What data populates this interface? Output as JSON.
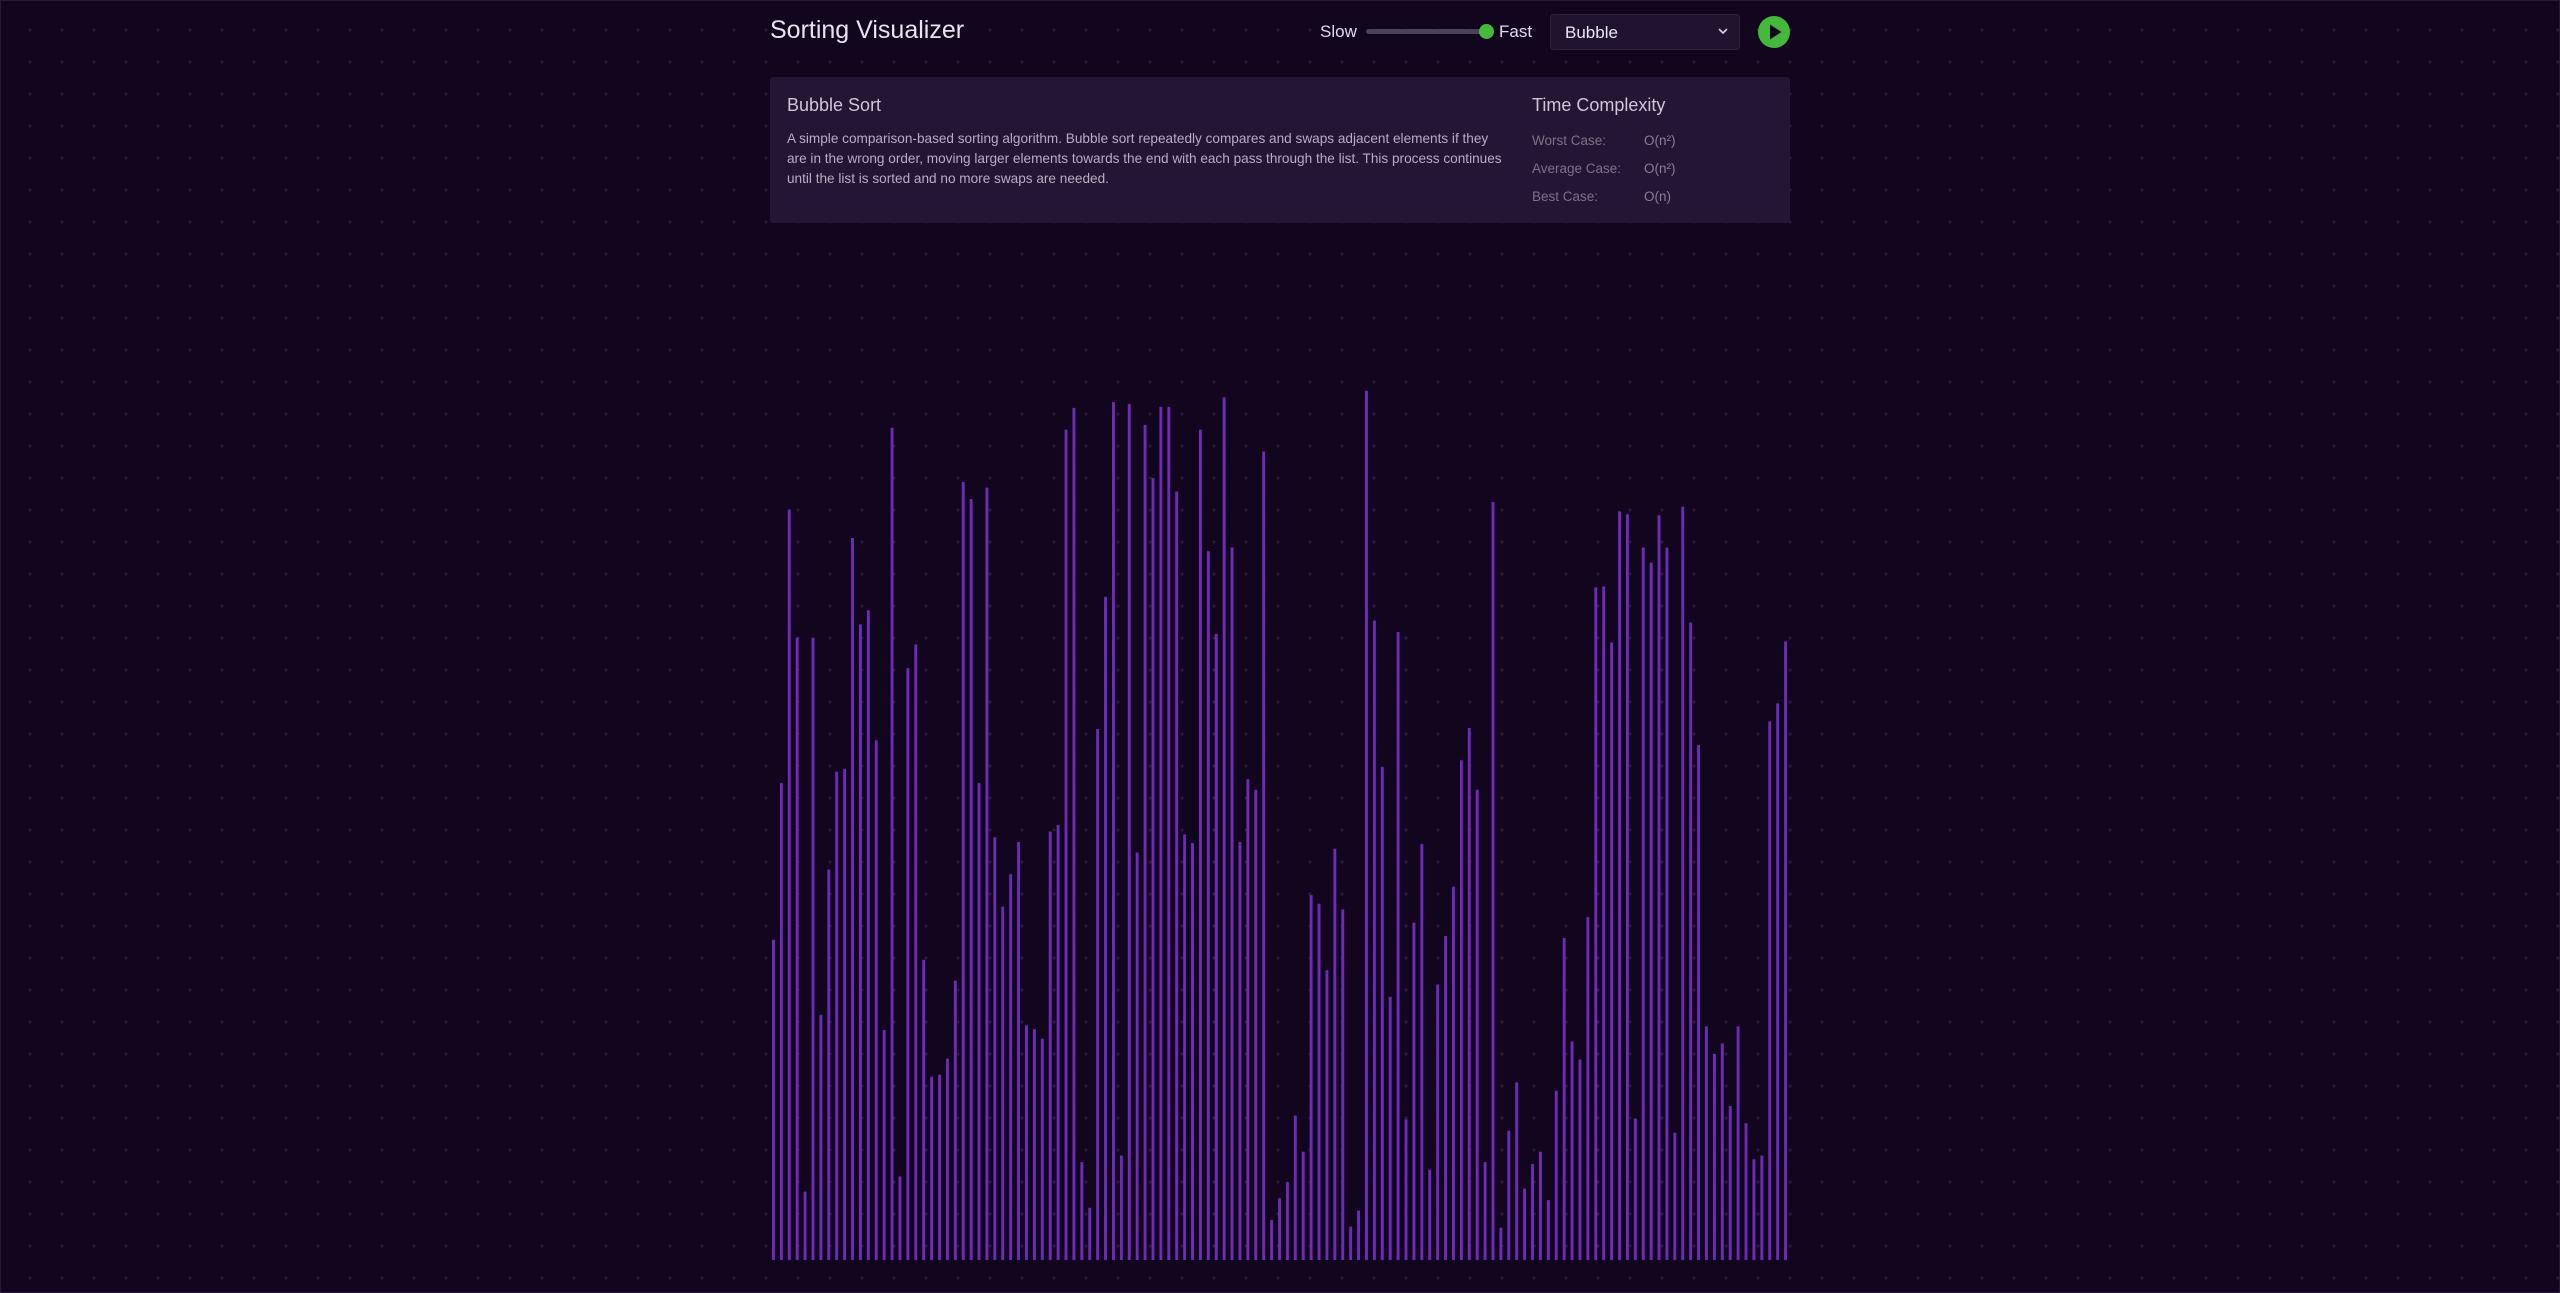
{
  "app": {
    "title": "Sorting Visualizer"
  },
  "speed": {
    "slow_label": "Slow",
    "fast_label": "Fast",
    "value": 1.0
  },
  "algorithm_select": {
    "selected": "Bubble",
    "icon": "chevron-down-icon"
  },
  "play_button": {
    "icon": "play-icon",
    "color": "#43b83a"
  },
  "info": {
    "name": "Bubble Sort",
    "description": "A simple comparison-based sorting algorithm. Bubble sort repeatedly compares and swaps adjacent elements if they are in the wrong order, moving larger elements towards the end with each pass through the list. This process continues until the list is sorted and no more swaps are needed.",
    "complexity_title": "Time Complexity",
    "complexity": [
      {
        "label": "Worst Case:",
        "value": "O(n²)"
      },
      {
        "label": "Average Case:",
        "value": "O(n²)"
      },
      {
        "label": "Best Case:",
        "value": "O(n)"
      }
    ]
  },
  "array": {
    "bar_color": "#6e2bb8",
    "values": [
      337,
      502,
      790,
      655,
      72,
      655,
      258,
      411,
      514,
      517,
      760,
      669,
      684,
      547,
      242,
      876,
      88,
      623,
      648,
      316,
      193,
      195,
      212,
      294,
      819,
      801,
      502,
      813,
      445,
      372,
      406,
      440,
      247,
      243,
      233,
      451,
      458,
      874,
      897,
      103,
      55,
      559,
      698,
      903,
      110,
      901,
      429,
      879,
      823,
      898,
      898,
      809,
      448,
      439,
      874,
      746,
      659,
      908,
      750,
      440,
      506,
      495,
      851,
      42,
      65,
      82,
      152,
      114,
      384,
      375,
      305,
      433,
      369,
      35,
      52,
      915,
      673,
      519,
      277,
      661,
      148,
      355,
      438,
      95,
      290,
      341,
      393,
      526,
      560,
      495,
      103,
      798,
      34,
      136,
      187,
      75,
      101,
      114,
      63,
      178,
      339,
      230,
      211,
      361,
      708,
      709,
      650,
      788,
      785,
      149,
      750,
      734,
      784,
      750,
      134,
      793,
      671,
      542,
      246,
      217,
      228,
      162,
      246,
      144,
      106,
      110,
      567,
      586,
      651
    ]
  }
}
